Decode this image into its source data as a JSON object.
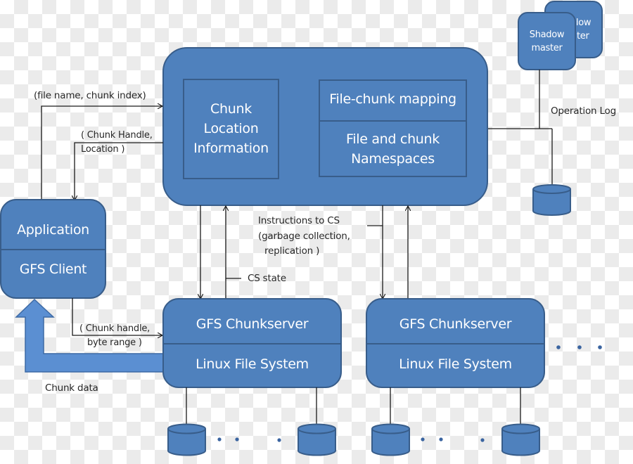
{
  "colors": {
    "box_fill": "#4f81bd",
    "box_border": "#385d8a",
    "arrow_fill": "#5b8fd2",
    "line": "#1a1a1a",
    "label_text": "#262626",
    "box_text": "#ffffff"
  },
  "shadow_masters": {
    "back_label": [
      "Shadow",
      "master"
    ],
    "front_label": [
      "Shadow",
      "master"
    ]
  },
  "master": {
    "chunk_location": [
      "Chunk",
      "Location",
      "Information"
    ],
    "file_chunk_mapping": "File-chunk mapping",
    "namespaces": [
      "File and chunk",
      "Namespaces"
    ]
  },
  "client": {
    "top": "Application",
    "bottom": "GFS Client"
  },
  "chunkservers": [
    {
      "top": "GFS Chunkserver",
      "bottom": "Linux File System"
    },
    {
      "top": "GFS Chunkserver",
      "bottom": "Linux File System"
    }
  ],
  "labels": {
    "file_name_chunk_index": "(file name, chunk index)",
    "chunk_handle_location": [
      "( Chunk Handle,",
      "Location )"
    ],
    "operation_log": "Operation Log",
    "instructions": [
      "Instructions to CS",
      "(garbage collection,",
      "replication )"
    ],
    "cs_state": "CS state",
    "chunk_handle_byte_range": [
      "( Chunk handle,",
      "byte range )"
    ],
    "chunk_data": "Chunk data"
  },
  "ellipsis": "• • •"
}
